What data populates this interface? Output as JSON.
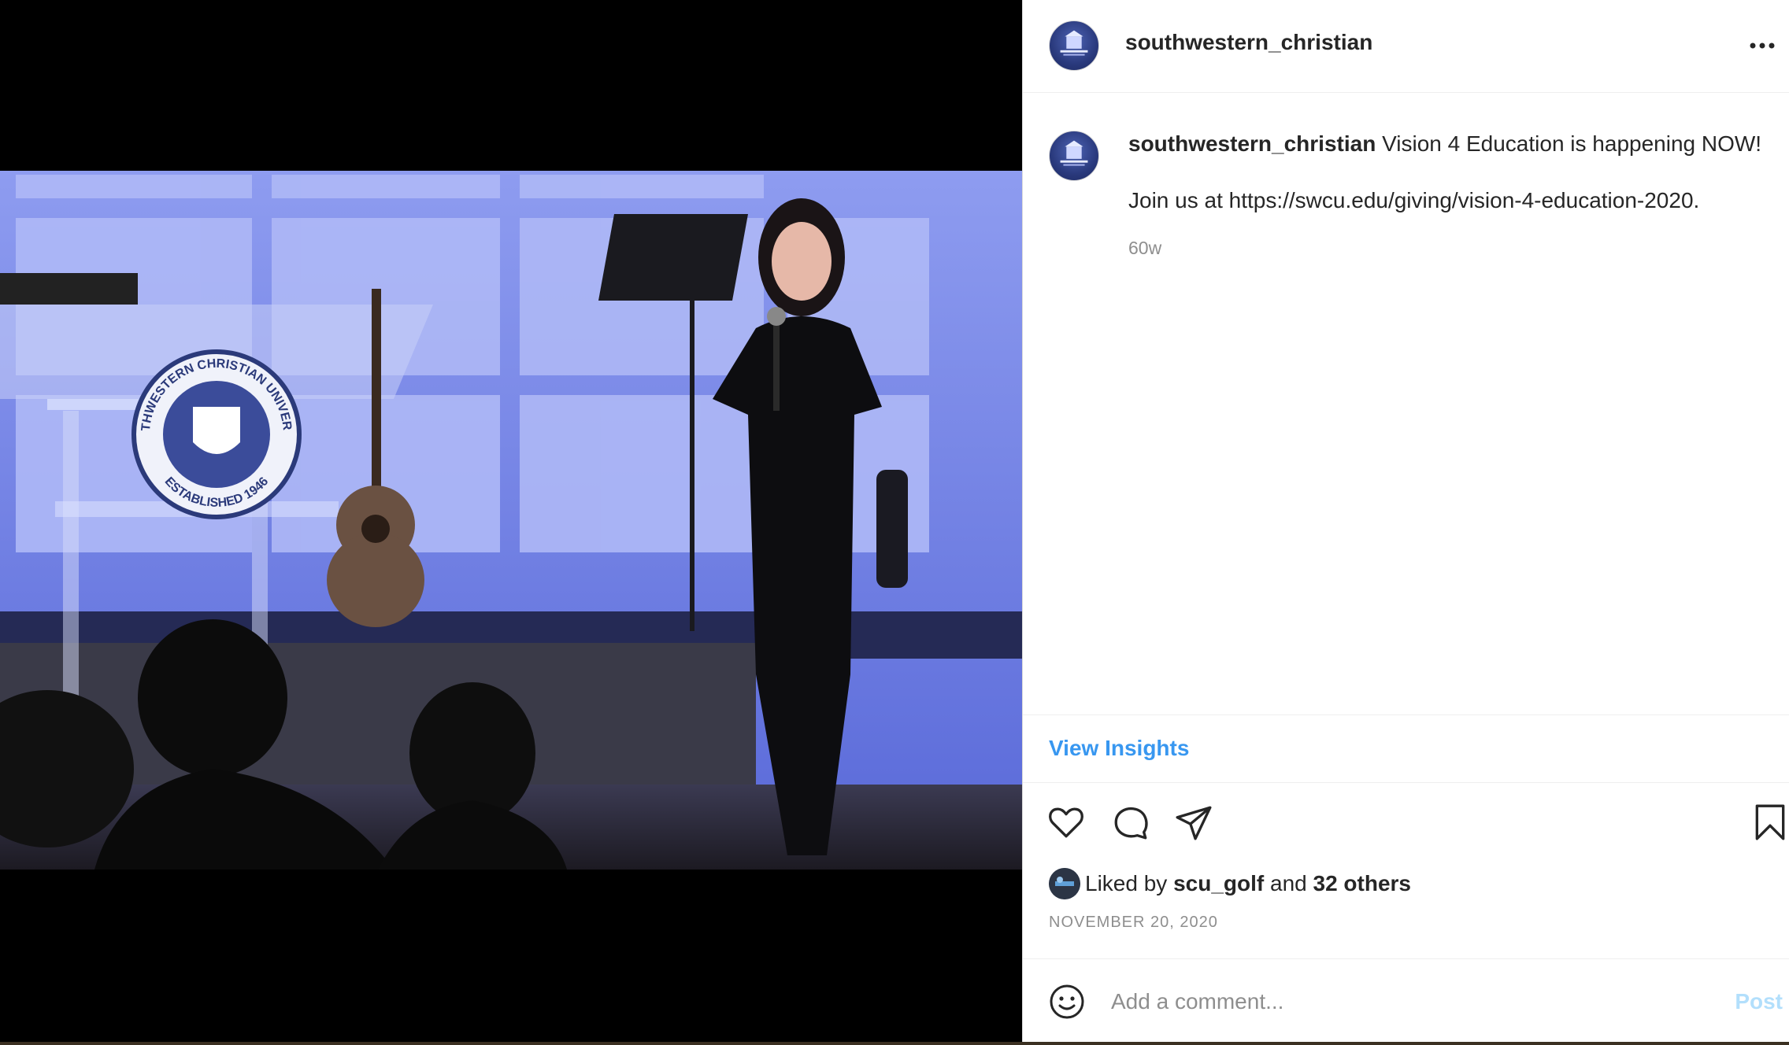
{
  "post": {
    "username": "southwestern_christian",
    "caption_text": "Vision 4 Education is happening NOW!",
    "caption_line2": "Join us at https://swcu.edu/giving/vision-4-education-2020.",
    "time_ago": "60w",
    "view_insights": "View Insights",
    "liked_by_prefix": "Liked by",
    "liked_by_user": "scu_golf",
    "liked_by_and": "and",
    "liked_by_others": "32 others",
    "date": "NOVEMBER 20, 2020",
    "comment_placeholder": "Add a comment...",
    "post_label": "Post"
  },
  "photo": {
    "seal_top_text": "SOUTHWESTERN CHRISTIAN UNIVERSITY",
    "seal_bottom_text": "ESTABLISHED 1946"
  },
  "icons": [
    "more-icon",
    "heart-icon",
    "comment-icon",
    "share-icon",
    "bookmark-icon",
    "emoji-icon"
  ],
  "colors": {
    "link": "#3897f0",
    "post_disabled": "#b2dffc",
    "text": "#262626",
    "muted": "#8e8e8e"
  }
}
